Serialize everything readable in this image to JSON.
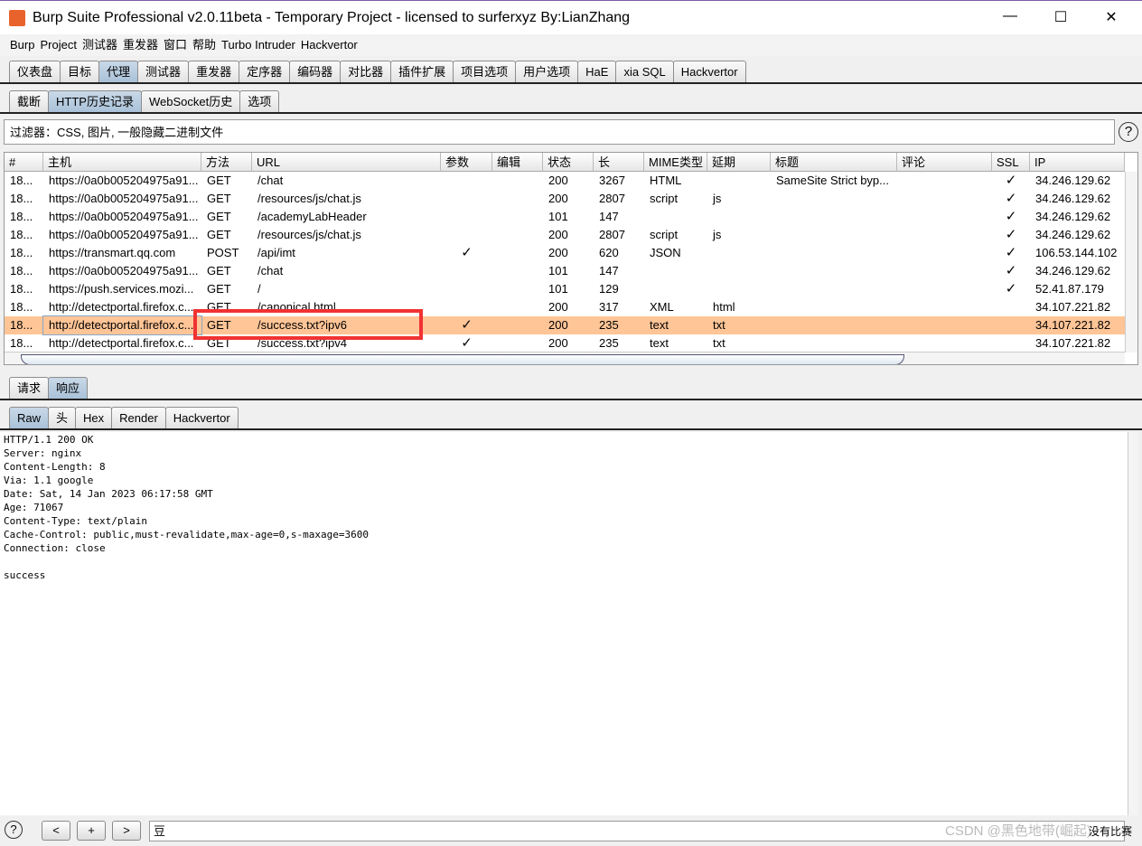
{
  "window": {
    "title": "Burp Suite Professional v2.0.11beta - Temporary Project - licensed to surferxyz By:LianZhang",
    "minimize": "—",
    "maximize": "☐",
    "close": "✕"
  },
  "menu": [
    "Burp",
    "Project",
    "测试器",
    "重发器",
    "窗口",
    "帮助",
    "Turbo Intruder",
    "Hackvertor"
  ],
  "main_tabs": [
    "仪表盘",
    "目标",
    "代理",
    "测试器",
    "重发器",
    "定序器",
    "编码器",
    "对比器",
    "插件扩展",
    "项目选项",
    "用户选项",
    "HaE",
    "xia SQL",
    "Hackvertor"
  ],
  "main_tab_selected": 2,
  "proxy_tabs": [
    "截断",
    "HTTP历史记录",
    "WebSocket历史",
    "选项"
  ],
  "proxy_tab_selected": 1,
  "filter": "过滤器：CSS, 图片, 一般隐藏二进制文件",
  "help": "?",
  "columns": [
    "#",
    "主机",
    "方法",
    "URL",
    "参数",
    "编辑",
    "状态",
    "长",
    "MIME类型",
    "延期",
    "标题",
    "评论",
    "SSL",
    "IP"
  ],
  "sort_indicator": "▲",
  "rows": [
    [
      "18...",
      "https://0a0b005204975a91...",
      "GET",
      "/chat",
      "",
      "",
      "200",
      "3267",
      "HTML",
      "",
      "SameSite Strict byp...",
      "",
      "✓",
      "34.246.129.62"
    ],
    [
      "18...",
      "https://0a0b005204975a91...",
      "GET",
      "/resources/js/chat.js",
      "",
      "",
      "200",
      "2807",
      "script",
      "js",
      "",
      "",
      "✓",
      "34.246.129.62"
    ],
    [
      "18...",
      "https://0a0b005204975a91...",
      "GET",
      "/academyLabHeader",
      "",
      "",
      "101",
      "147",
      "",
      "",
      "",
      "",
      "✓",
      "34.246.129.62"
    ],
    [
      "18...",
      "https://0a0b005204975a91...",
      "GET",
      "/resources/js/chat.js",
      "",
      "",
      "200",
      "2807",
      "script",
      "js",
      "",
      "",
      "✓",
      "34.246.129.62"
    ],
    [
      "18...",
      "https://transmart.qq.com",
      "POST",
      "/api/imt",
      "✓",
      "",
      "200",
      "620",
      "JSON",
      "",
      "",
      "",
      "✓",
      "106.53.144.102"
    ],
    [
      "18...",
      "https://0a0b005204975a91...",
      "GET",
      "/chat",
      "",
      "",
      "101",
      "147",
      "",
      "",
      "",
      "",
      "✓",
      "34.246.129.62"
    ],
    [
      "18...",
      "https://push.services.mozi...",
      "GET",
      "/",
      "",
      "",
      "101",
      "129",
      "",
      "",
      "",
      "",
      "✓",
      "52.41.87.179"
    ],
    [
      "18...",
      "http://detectportal.firefox.c...",
      "GET",
      "/canonical.html",
      "",
      "",
      "200",
      "317",
      "XML",
      "html",
      "",
      "",
      "",
      "34.107.221.82"
    ],
    [
      "18...",
      "http://detectportal.firefox.c...",
      "GET",
      "/success.txt?ipv6",
      "✓",
      "",
      "200",
      "235",
      "text",
      "txt",
      "",
      "",
      "",
      "34.107.221.82"
    ],
    [
      "18...",
      "http://detectportal.firefox.c...",
      "GET",
      "/success.txt?ipv4",
      "✓",
      "",
      "200",
      "235",
      "text",
      "txt",
      "",
      "",
      "",
      "34.107.221.82"
    ]
  ],
  "selected_row": 8,
  "msg_tabs": [
    "请求",
    "响应"
  ],
  "msg_tab_selected": 1,
  "view_tabs": [
    "Raw",
    "头",
    "Hex",
    "Render",
    "Hackvertor"
  ],
  "view_tab_selected": 0,
  "response": "HTTP/1.1 200 OK\nServer: nginx\nContent-Length: 8\nVia: 1.1 google\nDate: Sat, 14 Jan 2023 06:17:58 GMT\nAge: 71067\nContent-Type: text/plain\nCache-Control: public,must-revalidate,max-age=0,s-maxage=3600\nConnection: close\n\nsuccess",
  "bottom": {
    "prev": "<",
    "add": ">",
    "plus": "+",
    "next": ">",
    "search_value": "豆",
    "matches": "没有比赛",
    "watermark": "CSDN @黑色地带(崛起)"
  }
}
